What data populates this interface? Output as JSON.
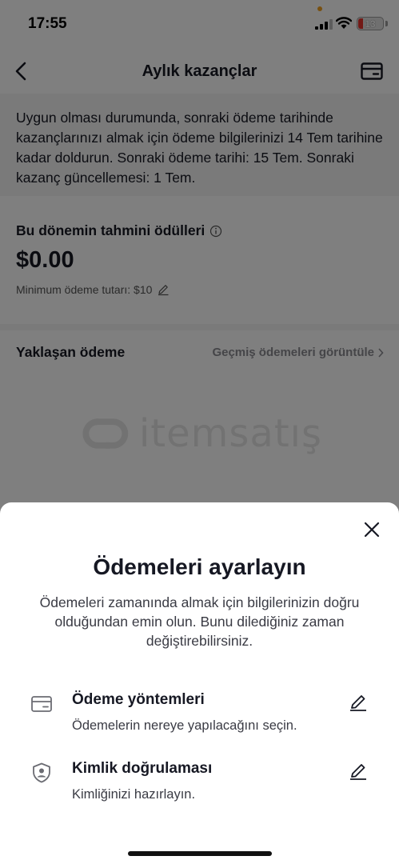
{
  "status_bar": {
    "time": "17:55",
    "battery": "13"
  },
  "nav": {
    "title": "Aylık kazançlar"
  },
  "info": {
    "text": "Uygun olması durumunda, sonraki ödeme tarihinde kazançlarınızı almak için ödeme bilgilerinizi 14 Tem tarihine kadar doldurun. Sonraki ödeme tarihi: 15 Tem. Sonraki kazanç güncellemesi: 1 Tem."
  },
  "earnings": {
    "title": "Bu dönemin tahmini ödülleri",
    "amount": "$0.00",
    "minimum": "Minimum ödeme tutarı: $10"
  },
  "upcoming": {
    "title": "Yaklaşan ödeme",
    "history_link": "Geçmiş ödemeleri görüntüle"
  },
  "watermark": {
    "text": "itemsatış"
  },
  "sheet": {
    "title": "Ödemeleri ayarlayın",
    "description": "Ödemeleri zamanında almak için bilgilerinizin doğru olduğundan emin olun. Bunu dilediğiniz zaman değiştirebilirsiniz.",
    "options": [
      {
        "icon": "card-icon",
        "title": "Ödeme yöntemleri",
        "subtitle": "Ödemelerin nereye yapılacağını seçin."
      },
      {
        "icon": "shield-user-icon",
        "title": "Kimlik doğrulaması",
        "subtitle": "Kimliğinizi hazırlayın."
      }
    ]
  },
  "colors": {
    "overlay": "#000000",
    "muted_text": "#8a8b91",
    "battery_low": "#e5322c"
  }
}
